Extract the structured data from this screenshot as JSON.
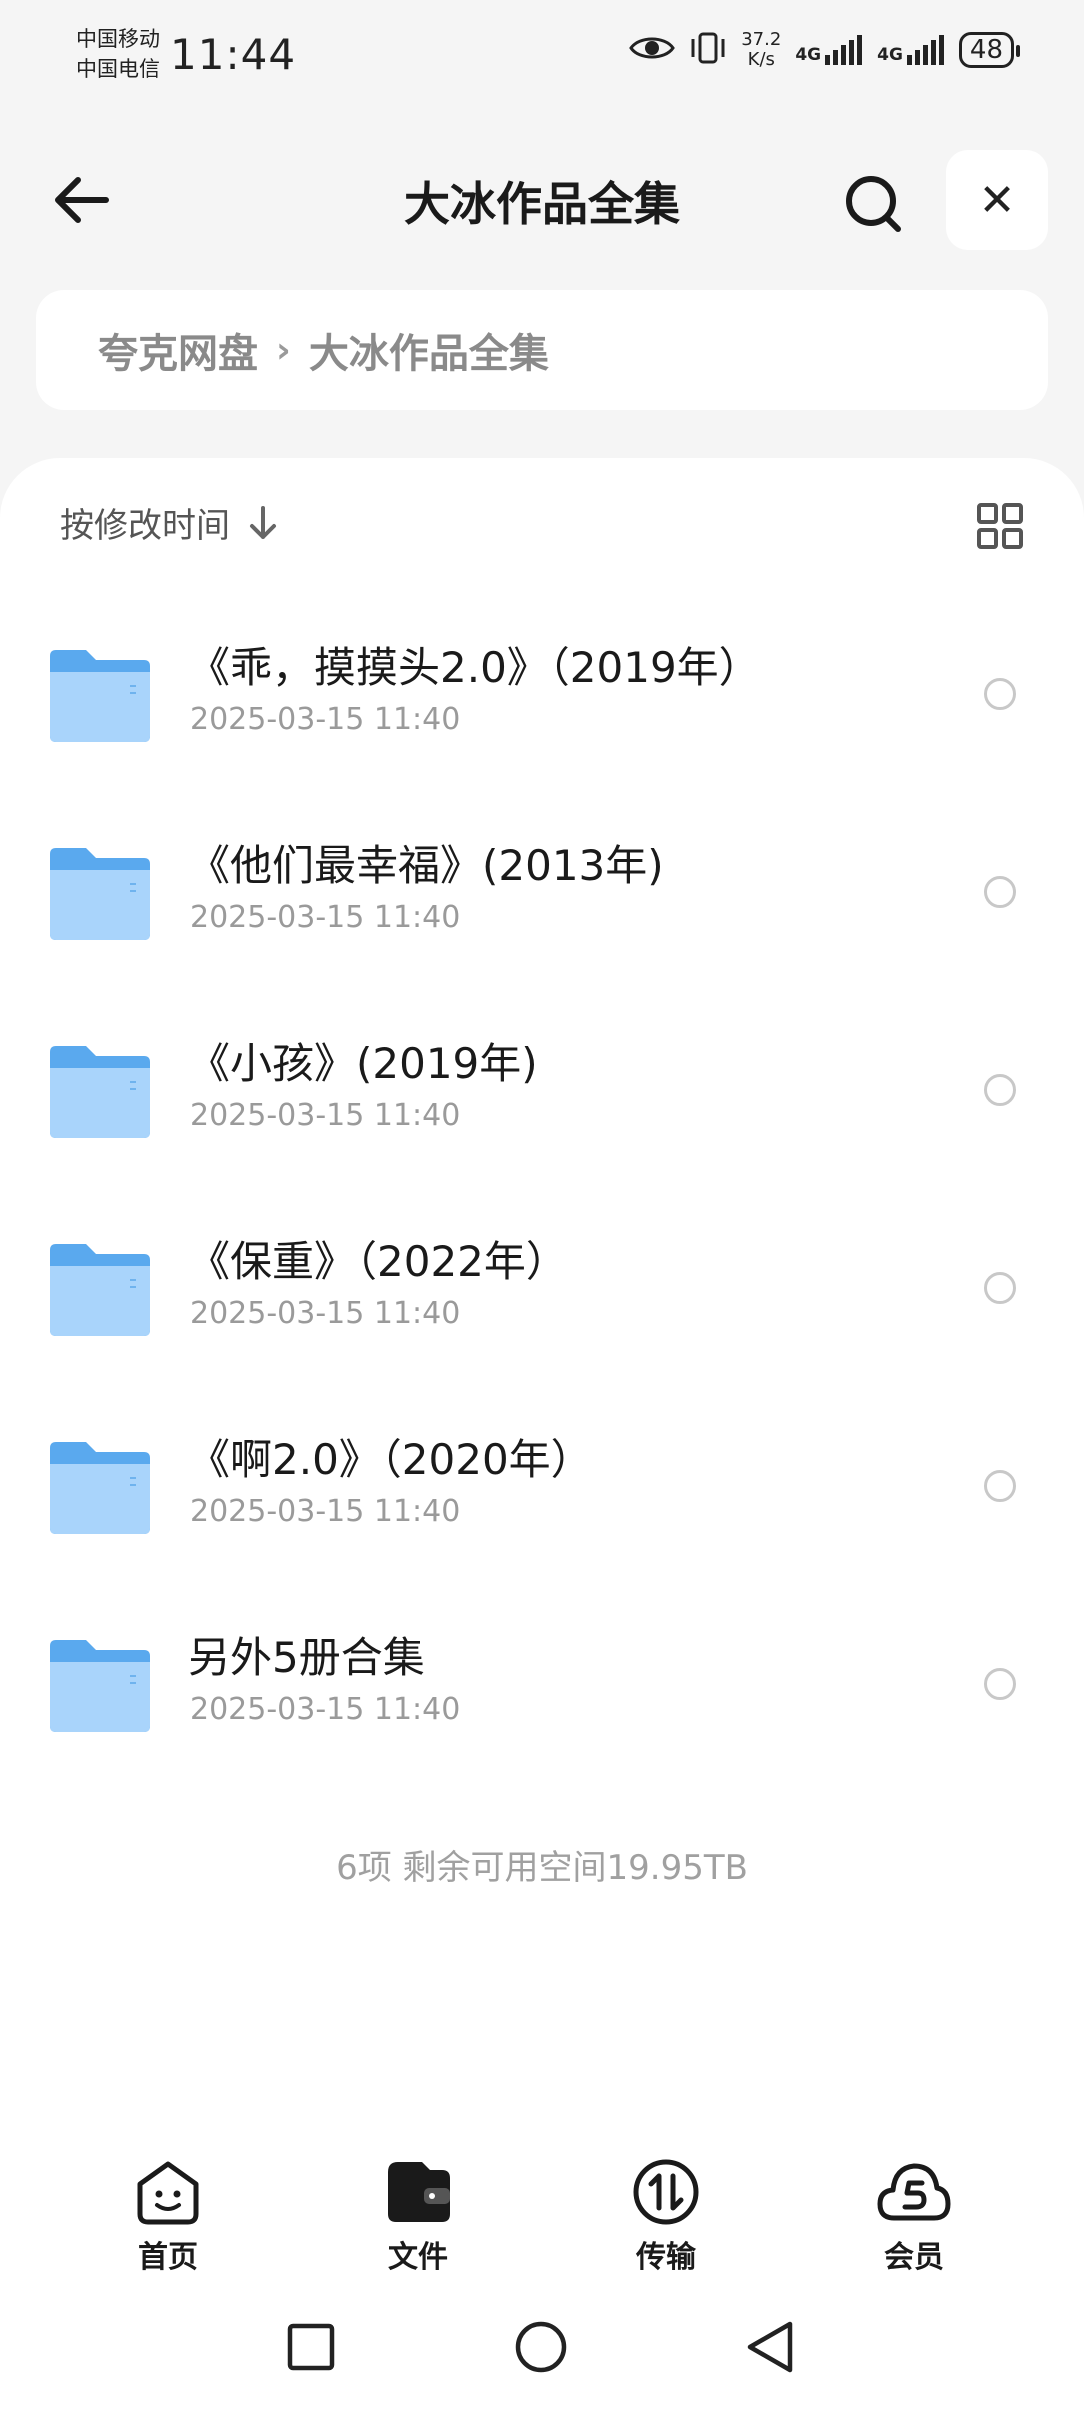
{
  "status_bar": {
    "carrier_1": "中国移动",
    "carrier_2": "中国电信",
    "time": "11:44",
    "speed_value": "37.2",
    "speed_unit": "K/s",
    "network_1": "4G",
    "network_2": "4G",
    "battery": "48"
  },
  "header": {
    "title": "大冰作品全集",
    "close_label": "✕"
  },
  "breadcrumb": {
    "items": [
      "夸克网盘",
      "大冰作品全集"
    ],
    "separator": "›"
  },
  "sort": {
    "label": "按修改时间"
  },
  "files": [
    {
      "name": "《乖，摸摸头2.0》（2019年）",
      "date": "2025-03-15 11:40"
    },
    {
      "name": "《他们最幸福》(2013年)",
      "date": "2025-03-15 11:40"
    },
    {
      "name": "《小孩》(2019年)",
      "date": "2025-03-15 11:40"
    },
    {
      "name": "《保重》（2022年）",
      "date": "2025-03-15 11:40"
    },
    {
      "name": "《啊2.0》（2020年）",
      "date": "2025-03-15 11:40"
    },
    {
      "name": "另外5册合集",
      "date": "2025-03-15 11:40"
    }
  ],
  "summary": "6项 剩余可用空间19.95TB",
  "bottom_nav": [
    {
      "label": "首页",
      "icon": "home-face-icon"
    },
    {
      "label": "文件",
      "icon": "wallet-folder-icon"
    },
    {
      "label": "传输",
      "icon": "transfer-icon"
    },
    {
      "label": "会员",
      "icon": "cloud-member-icon"
    }
  ],
  "colors": {
    "folder": "#5aa9ee",
    "folder_light": "#a9d4fb",
    "background": "#f5f5f5"
  }
}
